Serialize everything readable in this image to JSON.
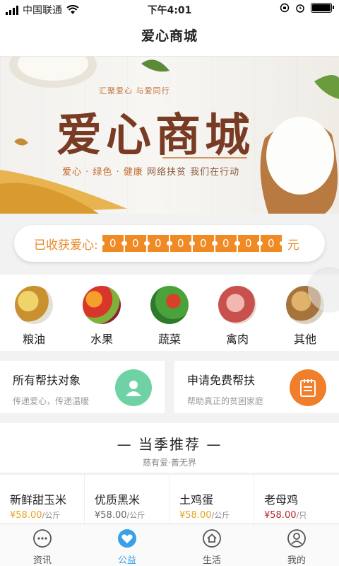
{
  "status_bar": {
    "carrier": "中国联通",
    "time": "下午4:01"
  },
  "header": {
    "title": "爱心商城"
  },
  "banner": {
    "tagline": "汇聚爱心  与爱同行",
    "title": "爱心商城",
    "slogan_left": "爱心 · 绿色 · 健康",
    "slogan_right": "网络扶贫  我们在行动"
  },
  "counter": {
    "label": "已收获爱心:",
    "digits": [
      "0",
      "0",
      "0",
      "0",
      "0",
      "0",
      "0",
      "0"
    ],
    "unit": "元"
  },
  "categories": [
    {
      "label": "粮油",
      "color": "#d8a85a"
    },
    {
      "label": "水果",
      "color": "#d84a36"
    },
    {
      "label": "蔬菜",
      "color": "#3f9a3a"
    },
    {
      "label": "禽肉",
      "color": "#c9615e"
    },
    {
      "label": "其他",
      "color": "#b98b52"
    }
  ],
  "cards": [
    {
      "title": "所有帮扶对象",
      "subtitle": "传递爱心，传递温暖",
      "icon": "person-icon",
      "color": "#6fd2a4"
    },
    {
      "title": "申请免费帮扶",
      "subtitle": "帮助真正的贫困家庭",
      "icon": "notepad-icon",
      "color": "#f07e2a"
    }
  ],
  "recommend": {
    "title": "— 当季推荐 —",
    "subtitle": "慈有爱·善无界"
  },
  "products": [
    {
      "name": "新鲜甜玉米",
      "price": "¥58.00",
      "unit": "/公斤",
      "color": "#e6a21e"
    },
    {
      "name": "优质黑米",
      "price": "¥58.00",
      "unit": "/公斤",
      "color": "#666666"
    },
    {
      "name": "土鸡蛋",
      "price": "¥58.00",
      "unit": "/公斤",
      "color": "#e6a21e"
    },
    {
      "name": "老母鸡",
      "price": "¥58.00",
      "unit": "/只",
      "color": "#b5282a"
    }
  ],
  "tabs": [
    {
      "label": "资讯",
      "icon": "chat-bubble-icon"
    },
    {
      "label": "公益",
      "icon": "heart-hands-icon"
    },
    {
      "label": "生活",
      "icon": "home-icon"
    },
    {
      "label": "我的",
      "icon": "user-icon"
    }
  ]
}
